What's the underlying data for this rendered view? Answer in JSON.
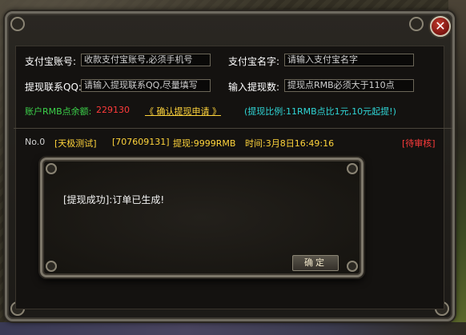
{
  "form": {
    "alipay_account_label": "支付宝账号:",
    "alipay_account_placeholder": "收款支付宝账号,必须手机号",
    "alipay_name_label": "支付宝名字:",
    "alipay_name_placeholder": "请输入支付宝名字",
    "contact_qq_label": "提现联系QQ:",
    "contact_qq_placeholder": "请输入提现联系QQ,尽量填写",
    "withdraw_amount_label": "输入提现数:",
    "withdraw_amount_placeholder": "提现点RMB必须大于110点"
  },
  "account": {
    "balance_label": "账户RMB点余额:",
    "balance_value": "229130",
    "confirm_label": "《  确认提现申请  》",
    "ratio_note": "(提现比例:11RMB点比1元,10元起提!)"
  },
  "records": [
    {
      "no": "No.0",
      "name": "[天极测试]",
      "id": "[707609131]",
      "amount": "提现:9999RMB",
      "time": "时间:3月8日16:49:16",
      "status": "[待审核]"
    }
  ],
  "dialog": {
    "message": "[提现成功]:订单已生成!",
    "ok_label": "确定"
  },
  "icons": {
    "close": "close-icon"
  },
  "colors": {
    "balance_label": "#3cd14a",
    "balance_value": "#ff3b3b",
    "confirm_link": "#ffd43b",
    "ratio_note": "#2fd6d6",
    "status_pending": "#ff3b3b",
    "close_button": "#c0392b"
  }
}
